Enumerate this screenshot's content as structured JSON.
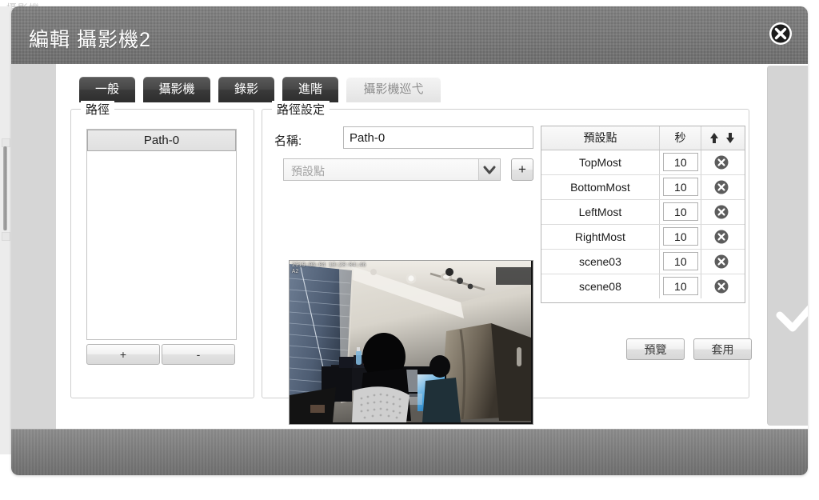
{
  "window": {
    "title": "編輯 攝影機2",
    "close_icon": "close-circle-icon",
    "ghost_text": "攝影機"
  },
  "tabs": [
    {
      "label": "一般",
      "active": false
    },
    {
      "label": "攝影機",
      "active": false
    },
    {
      "label": "錄影",
      "active": false
    },
    {
      "label": "進階",
      "active": false
    },
    {
      "label": "攝影機巡弋",
      "active": true
    }
  ],
  "path_panel": {
    "legend": "路徑",
    "items": [
      {
        "label": "Path-0",
        "selected": true
      }
    ],
    "add_label": "+",
    "remove_label": "-"
  },
  "path_settings": {
    "legend": "路徑設定",
    "name_label": "名稱:",
    "name_value": "Path-0",
    "preset_select_placeholder": "預設點",
    "preset_select_value": "",
    "dropdown_icon": "chevron-down-icon",
    "add_preset_label": "+",
    "video": {
      "timestamp": "2019-06-04 13:28:04:46",
      "second_line": "A2"
    },
    "table": {
      "headers": {
        "name": "預設點",
        "seconds": "秒",
        "order_up_icon": "arrow-up-icon",
        "order_down_icon": "arrow-down-icon"
      },
      "rows": [
        {
          "name": "TopMost",
          "seconds": "10",
          "delete_icon": "delete-circle-icon"
        },
        {
          "name": "BottomMost",
          "seconds": "10",
          "delete_icon": "delete-circle-icon"
        },
        {
          "name": "LeftMost",
          "seconds": "10",
          "delete_icon": "delete-circle-icon"
        },
        {
          "name": "RightMost",
          "seconds": "10",
          "delete_icon": "delete-circle-icon"
        },
        {
          "name": "scene03",
          "seconds": "10",
          "delete_icon": "delete-circle-icon"
        },
        {
          "name": "scene08",
          "seconds": "10",
          "delete_icon": "delete-circle-icon"
        }
      ]
    },
    "preview_label": "預覽",
    "apply_label": "套用"
  },
  "right_panel": {
    "confirm_icon": "checkmark-icon"
  },
  "colors": {
    "titlebar": "#787878",
    "tab_inactive": "#3a3a3a",
    "tab_active": "#ececec",
    "panel_gray": "#d4d4d4"
  }
}
